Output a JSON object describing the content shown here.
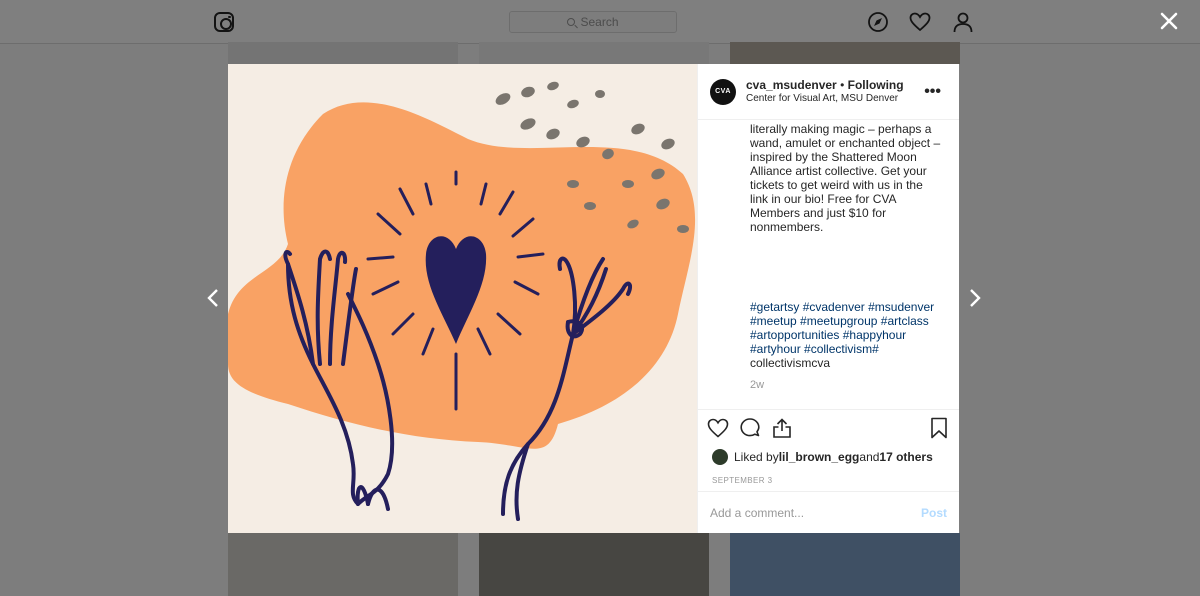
{
  "search": {
    "placeholder": "Search"
  },
  "post": {
    "avatar_text": "CVA",
    "username": "cva_msudenver",
    "separator": " • ",
    "following": "Following",
    "location": "Center for Visual Art, MSU Denver",
    "more": "•••",
    "caption": "literally making magic – perhaps a wand, amulet or enchanted object – inspired by the Shattered Moon Alliance artist collective. Get your tickets to get weird with us in the link in our bio! Free for CVA Members and just $10 for nonmembers.",
    "hashtags": [
      "#getartsy",
      "#cvadenver",
      "#msudenver",
      "#meetup",
      "#meetupgroup",
      "#artclass",
      "#artopportunities",
      "#happyhour",
      "#artyhour",
      "#collectivism#"
    ],
    "hashtag_tail": "collectivismcva",
    "time_ago": "2w",
    "liked_prefix": "Liked by ",
    "liked_user": "lil_brown_egg",
    "liked_and": " and ",
    "liked_others": "17 others",
    "date": "SEPTEMBER 3",
    "comment_placeholder": "Add a comment...",
    "post_label": "Post"
  },
  "colors": {
    "orange": "#f9a264",
    "navy": "#241f5c",
    "cream": "#f5ede4",
    "link": "#003569"
  },
  "icons": {
    "logo": "instagram-logo-icon",
    "explore": "compass-icon",
    "activity": "heart-icon",
    "profile": "person-icon",
    "close": "close-icon",
    "prev": "chevron-left-icon",
    "next": "chevron-right-icon",
    "like": "heart-outline-icon",
    "comment": "speech-bubble-icon",
    "share": "share-icon",
    "save": "bookmark-icon"
  }
}
